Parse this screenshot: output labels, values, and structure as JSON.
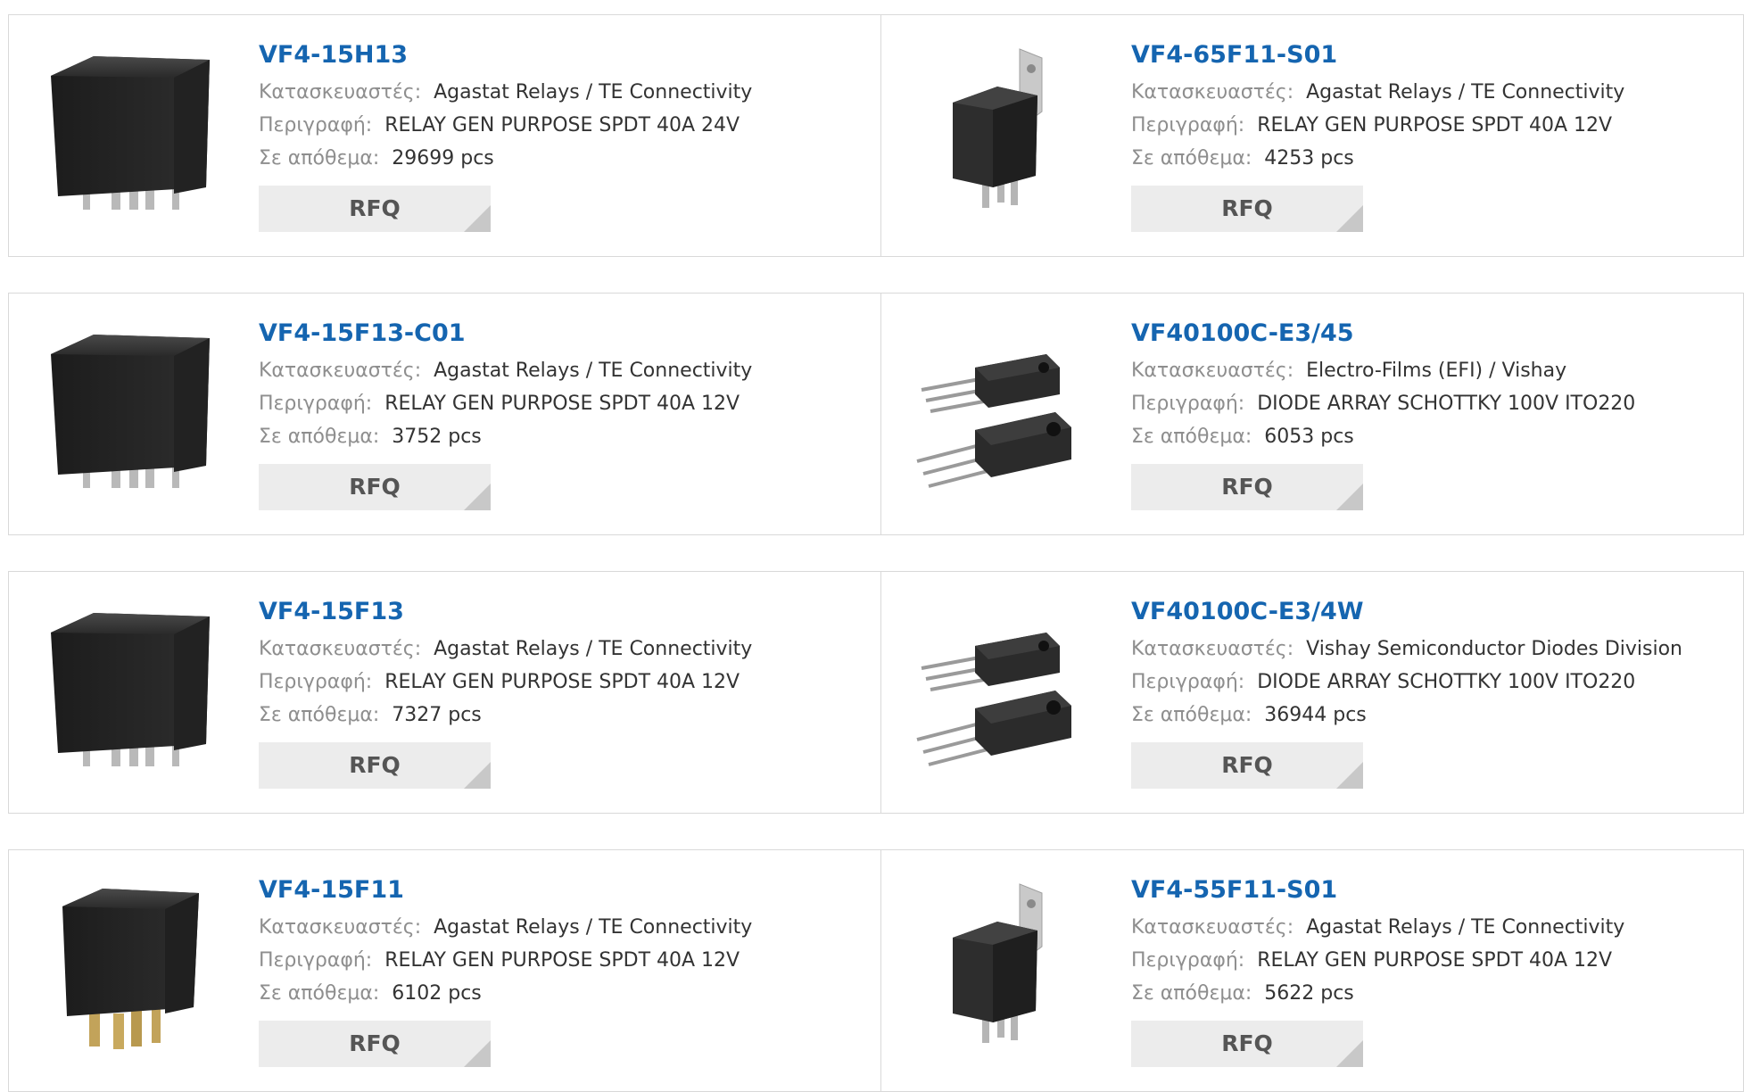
{
  "labels": {
    "manufacturer": "Κατασκευαστές:",
    "description": "Περιγραφή:",
    "stock": "Σε απόθεμα:",
    "rfq": "RFQ"
  },
  "products": [
    {
      "part": "VF4-15H13",
      "manufacturer": "Agastat Relays / TE Connectivity",
      "description": "RELAY GEN PURPOSE SPDT 40A 24V",
      "stock": "29699 pcs",
      "image": "relay-icon"
    },
    {
      "part": "VF4-65F11-S01",
      "manufacturer": "Agastat Relays / TE Connectivity",
      "description": "RELAY GEN PURPOSE SPDT 40A 12V",
      "stock": "4253 pcs",
      "image": "bracket-relay-icon"
    },
    {
      "part": "VF4-15F13-C01",
      "manufacturer": "Agastat Relays / TE Connectivity",
      "description": "RELAY GEN PURPOSE SPDT 40A 12V",
      "stock": "3752 pcs",
      "image": "relay-icon"
    },
    {
      "part": "VF40100C-E3/45",
      "manufacturer": "Electro-Films (EFI) / Vishay",
      "description": "DIODE ARRAY SCHOTTKY 100V ITO220",
      "stock": "6053 pcs",
      "image": "diode-package-icon"
    },
    {
      "part": "VF4-15F13",
      "manufacturer": "Agastat Relays / TE Connectivity",
      "description": "RELAY GEN PURPOSE SPDT 40A 12V",
      "stock": "7327 pcs",
      "image": "relay-icon"
    },
    {
      "part": "VF40100C-E3/4W",
      "manufacturer": "Vishay Semiconductor Diodes Division",
      "description": "DIODE ARRAY SCHOTTKY 100V ITO220",
      "stock": "36944 pcs",
      "image": "diode-package-icon"
    },
    {
      "part": "VF4-15F11",
      "manufacturer": "Agastat Relays / TE Connectivity",
      "description": "RELAY GEN PURPOSE SPDT 40A 12V",
      "stock": "6102 pcs",
      "image": "relay-brass-pins-icon"
    },
    {
      "part": "VF4-55F11-S01",
      "manufacturer": "Agastat Relays / TE Connectivity",
      "description": "RELAY GEN PURPOSE SPDT 40A 12V",
      "stock": "5622 pcs",
      "image": "bracket-relay-icon"
    }
  ]
}
